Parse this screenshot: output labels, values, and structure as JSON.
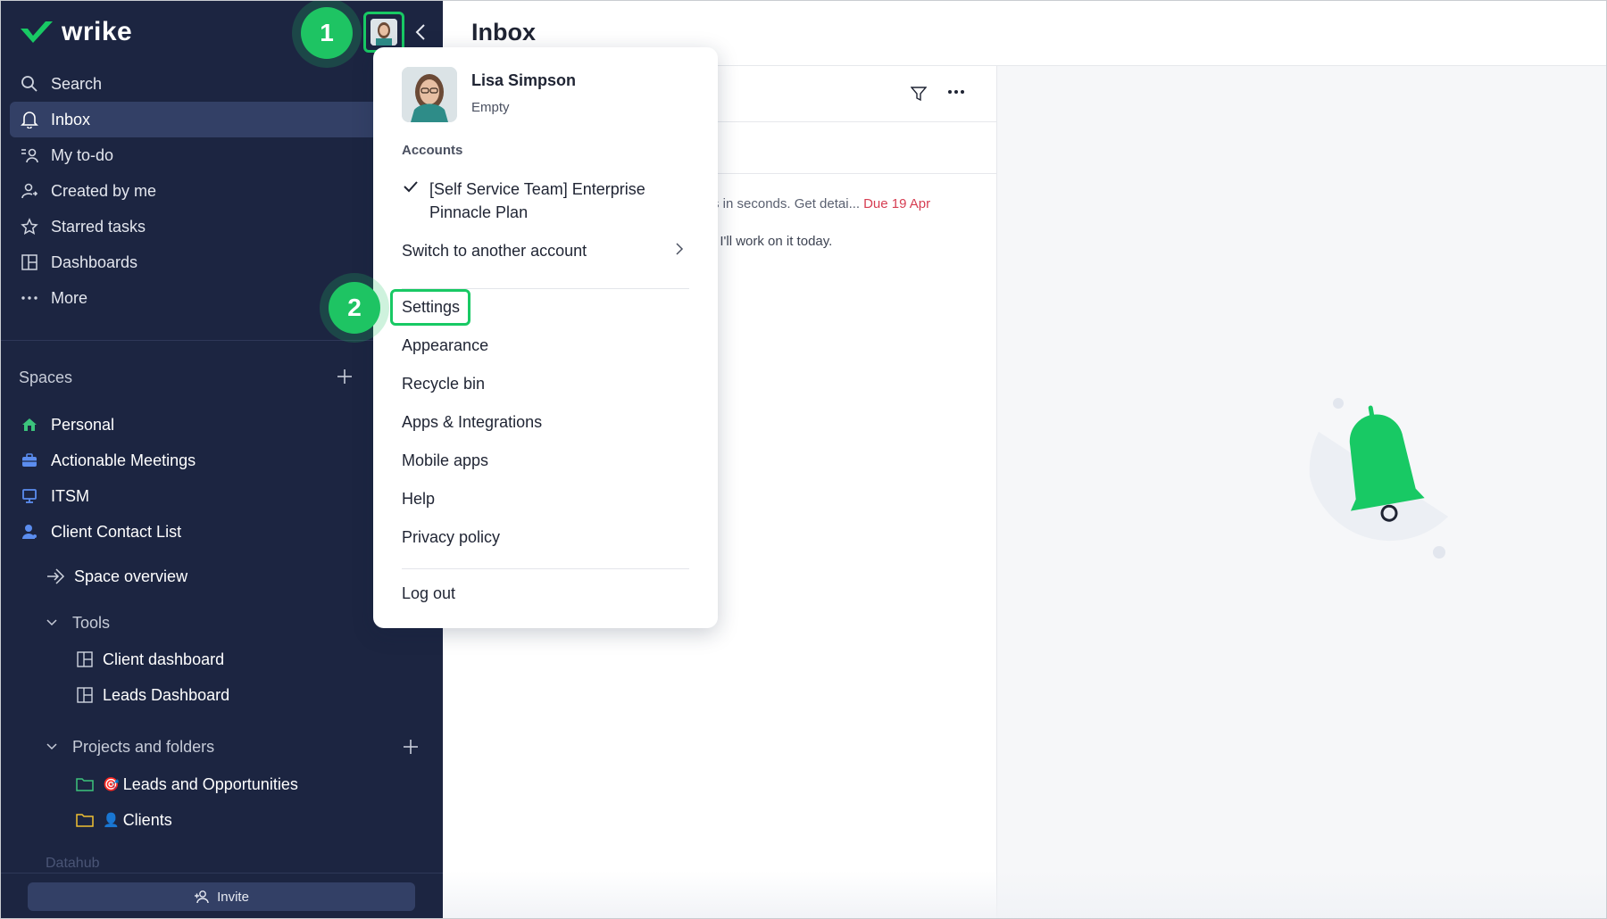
{
  "app": {
    "logo_text": "wrike",
    "brand_color": "#18c964",
    "sidebar_color": "#1c2541"
  },
  "sidebar": {
    "nav": [
      {
        "label": "Search",
        "icon": "search-icon",
        "active": false
      },
      {
        "label": "Inbox",
        "icon": "bell-icon",
        "active": true
      },
      {
        "label": "My to-do",
        "icon": "todo-icon",
        "active": false
      },
      {
        "label": "Created by me",
        "icon": "user-arrow-icon",
        "active": false
      },
      {
        "label": "Starred tasks",
        "icon": "star-icon",
        "active": false
      },
      {
        "label": "Dashboards",
        "icon": "dashboard-icon",
        "active": false
      },
      {
        "label": "More",
        "icon": "more-dots-icon",
        "active": false
      }
    ],
    "spaces_title": "Spaces",
    "spaces": [
      {
        "label": "Personal",
        "icon": "home-icon"
      },
      {
        "label": "Actionable Meetings",
        "icon": "briefcase-icon"
      },
      {
        "label": "ITSM",
        "icon": "monitor-icon"
      },
      {
        "label": "Client Contact List",
        "icon": "person-icon"
      }
    ],
    "space_overview": "Space overview",
    "tools_title": "Tools",
    "tools": [
      {
        "label": "Client dashboard"
      },
      {
        "label": "Leads Dashboard"
      }
    ],
    "projects_title": "Projects and folders",
    "projects": [
      {
        "label": "Leads and Opportunities",
        "emoji": "🎯"
      },
      {
        "label": "Clients",
        "emoji": "👤"
      }
    ],
    "datahub_label": "Datahub",
    "invite_label": "Invite"
  },
  "badges": {
    "step1": "1",
    "step2": "2"
  },
  "main": {
    "title": "Inbox",
    "notifications": [
      {
        "text": "s in seconds. Get detai...",
        "due": "Due 19 Apr"
      },
      {
        "text": ", I'll work on it today."
      }
    ]
  },
  "dropdown": {
    "user_name": "Lisa Simpson",
    "user_status": "Empty",
    "accounts_title": "Accounts",
    "current_account": "[Self Service Team] Enterprise Pinnacle Plan",
    "switch_account": "Switch to another account",
    "items": [
      "Settings",
      "Appearance",
      "Recycle bin",
      "Apps & Integrations",
      "Mobile apps",
      "Help",
      "Privacy policy"
    ],
    "logout": "Log out"
  }
}
